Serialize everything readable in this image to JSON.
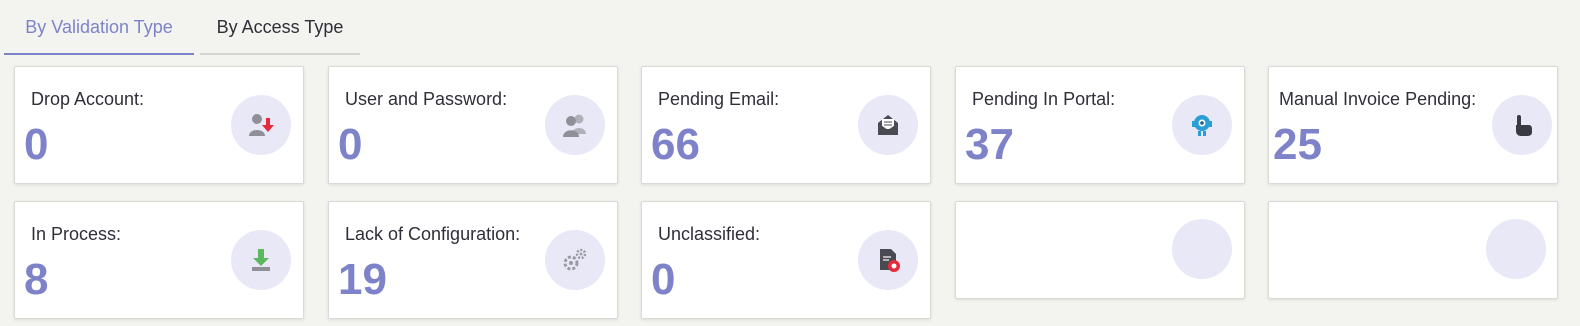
{
  "tabs": [
    {
      "label": "By Validation Type",
      "active": true
    },
    {
      "label": "By Access Type",
      "active": false
    }
  ],
  "colors": {
    "accent": "#7e83c9",
    "icon_bg": "#e8e8f7",
    "card_bg": "#ffffff",
    "page_bg": "#f3f3ef"
  },
  "cards": [
    {
      "label": "Drop Account:",
      "value": "0",
      "icon": "user-download-icon"
    },
    {
      "label": "User and Password:",
      "value": "0",
      "icon": "users-icon"
    },
    {
      "label": "Pending Email:",
      "value": "66",
      "icon": "envelope-open-icon"
    },
    {
      "label": "Pending In Portal:",
      "value": "37",
      "icon": "robot-icon"
    },
    {
      "label": "Manual Invoice Pending:",
      "value": "25",
      "icon": "hand-pointer-icon"
    },
    {
      "label": "In Process:",
      "value": "8",
      "icon": "download-icon"
    },
    {
      "label": "Lack of Configuration:",
      "value": "19",
      "icon": "gears-icon"
    },
    {
      "label": "Unclassified:",
      "value": "0",
      "icon": "file-error-icon"
    },
    {
      "label": "",
      "value": "",
      "icon": ""
    },
    {
      "label": "",
      "value": "",
      "icon": ""
    }
  ]
}
